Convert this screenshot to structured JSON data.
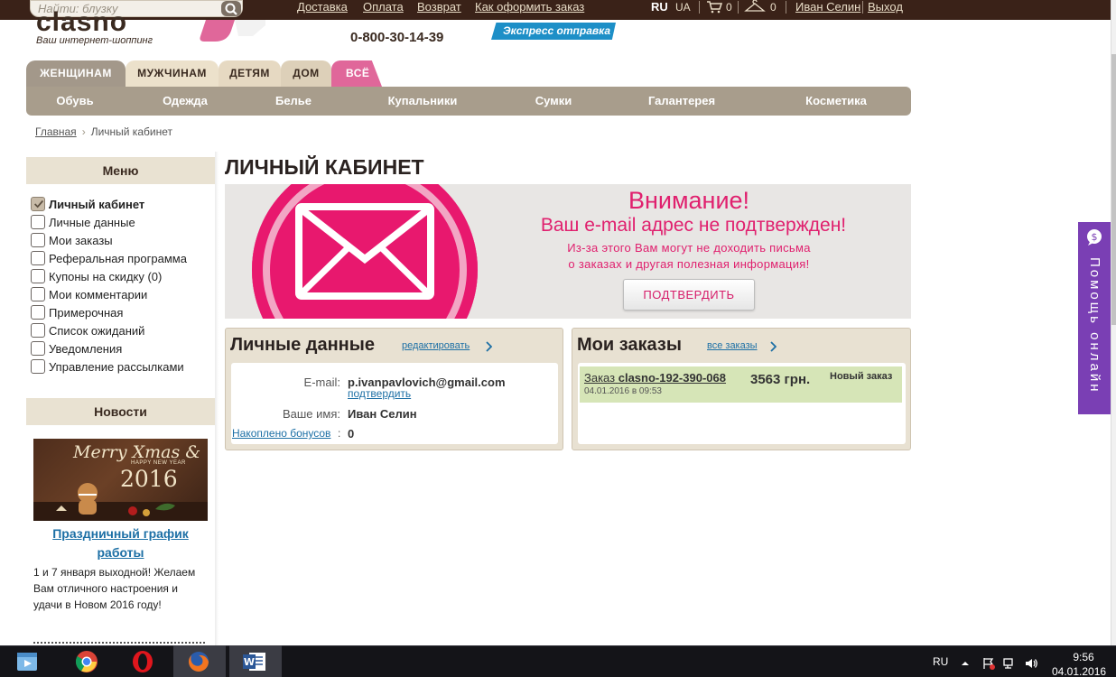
{
  "topbar": {
    "search_placeholder": "Найти: блузку",
    "links": [
      "Доставка",
      "Оплата",
      "Возврат",
      "Как оформить заказ"
    ],
    "lang_active": "RU",
    "lang_other": "UA",
    "cart_count": "0",
    "wishlist_count": "0",
    "user_name": "Иван Селин",
    "logout": "Выход"
  },
  "header": {
    "logo_text": "clasno",
    "tagline": "Ваш интернет-шоппинг",
    "phone": "0-800-30-14-39",
    "express_badge": "Экспресс отправка"
  },
  "category_tabs": [
    "ЖЕНЩИНАМ",
    "МУЖЧИНАМ",
    "ДЕТЯМ",
    "ДОМ",
    "ВСЁ"
  ],
  "subnav": [
    "Обувь",
    "Одежда",
    "Белье",
    "Купальники",
    "Сумки",
    "Галантерея",
    "Косметика"
  ],
  "breadcrumb": {
    "home": "Главная",
    "current": "Личный кабинет"
  },
  "sidebar": {
    "menu_title": "Меню",
    "items": [
      "Личный кабинет",
      "Личные данные",
      "Мои заказы",
      "Реферальная программа",
      "Купоны на скидку (0)",
      "Мои комментарии",
      "Примерочная",
      "Список ожиданий",
      "Уведомления",
      "Управление рассылками"
    ],
    "news_title": "Новости",
    "news_image_text_1": "Merry Xmas &",
    "news_image_text_2": "HAPPY NEW YEAR",
    "news_image_text_3": "2016",
    "news_item_title": "Праздничный график работы",
    "news_item_text": "1 и 7 января выходной! Желаем Вам отличного настроения и удачи в Новом 2016 году!"
  },
  "main": {
    "page_title": "ЛИЧНЫЙ КАБИНЕТ",
    "banner": {
      "heading": "Внимание!",
      "subheading": "Ваш e-mail адрес не подтвержден!",
      "text_line1": "Из-за этого Вам могут не доходить письма",
      "text_line2": "о заказах и другая полезная информация!",
      "button": "ПОДТВЕРДИТЬ"
    },
    "personal": {
      "title": "Личные данные",
      "edit_link": "редактировать",
      "email_label": "E-mail:",
      "email_value": "p.ivanpavlovich@gmail.com",
      "confirm_link": "подтвердить",
      "name_label": "Ваше имя:",
      "name_value": "Иван Селин",
      "bonus_label": "Накоплено бонусов",
      "bonus_colon": ":",
      "bonus_value": "0"
    },
    "orders": {
      "title": "Мои заказы",
      "all_link": "все заказы",
      "order_prefix": "Заказ",
      "order_number": "clasno-192-390-068",
      "order_date": "04.01.2016 в 09:53",
      "order_amount": "3563 грн.",
      "order_status": "Новый заказ"
    }
  },
  "help_tab": {
    "label": "Помощь онлайн"
  },
  "taskbar": {
    "lang": "RU",
    "time": "9:56",
    "date": "04.01.2016"
  },
  "colors": {
    "topbar": "#3a2218",
    "accent_pink": "#e0206e",
    "link_blue": "#1c6fa5",
    "help_purple": "#7a3fb4"
  }
}
